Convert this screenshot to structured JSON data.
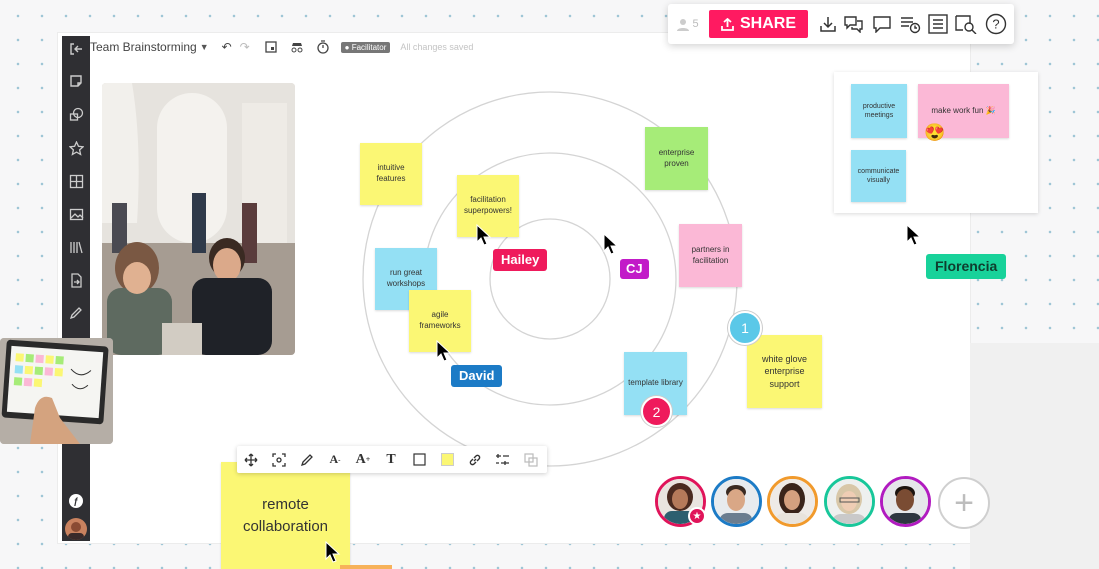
{
  "header": {
    "board_title": "Team Brainstorming",
    "role_badge": "Facilitator",
    "save_status": "All changes saved"
  },
  "share_bar": {
    "viewer_count": "5",
    "share_label": "SHARE",
    "icons": [
      "user-icon",
      "upload-icon",
      "download-icon",
      "comments-icon",
      "chat-icon",
      "activity-icon",
      "list-icon",
      "search-icon",
      "help-icon"
    ]
  },
  "sidebar": {
    "icons": [
      "exit-icon",
      "sticky-note-icon",
      "shapes-icon",
      "star-icon",
      "frame-icon",
      "image-icon",
      "library-icon",
      "import-icon",
      "pen-icon",
      "apps-icon",
      "avatar"
    ]
  },
  "stickies": [
    {
      "id": "intuitive",
      "text": "intuitive features",
      "color": "#fbf774"
    },
    {
      "id": "facilitation",
      "text": "facilitation superpowers!",
      "color": "#fbf774"
    },
    {
      "id": "enterprise",
      "text": "enterprise proven",
      "color": "#a6ec78"
    },
    {
      "id": "workshops",
      "text": "run great workshops",
      "color": "#94e0f4"
    },
    {
      "id": "agile",
      "text": "agile frameworks",
      "color": "#fbf774"
    },
    {
      "id": "partners",
      "text": "partners in facilitation",
      "color": "#fbb8d6"
    },
    {
      "id": "template",
      "text": "template library",
      "color": "#94e0f4"
    },
    {
      "id": "whiteglove",
      "text": "white glove enterprise support",
      "color": "#fbf774"
    },
    {
      "id": "productive",
      "text": "productive meetings",
      "color": "#94e0f4"
    },
    {
      "id": "fun",
      "text": "make work fun 🎉",
      "color": "#fbb8d6"
    },
    {
      "id": "visually",
      "text": "communicate visually",
      "color": "#94e0f4"
    },
    {
      "id": "remote",
      "text": "remote collaboration",
      "color": "#fbf774"
    }
  ],
  "emoji": "😍",
  "collaborators": [
    {
      "name": "Hailey",
      "color": "#ef1a5c"
    },
    {
      "name": "CJ",
      "color": "#c21bc8"
    },
    {
      "name": "David",
      "color": "#1c7bc6"
    },
    {
      "name": "Florencia",
      "color": "#18d29a"
    }
  ],
  "markers": [
    {
      "label": "1",
      "color": "#5bc8e8"
    },
    {
      "label": "2",
      "color": "#ef1a5c"
    }
  ],
  "format_toolbar": {
    "icons": [
      "move-icon",
      "focus-icon",
      "pen-icon",
      "font-smaller-icon",
      "font-larger-icon",
      "text-icon",
      "border-icon",
      "fill-color-icon",
      "link-icon",
      "align-icon",
      "duplicate-icon"
    ],
    "font_smaller": "A",
    "font_larger": "A",
    "text": "T",
    "fill_color": "#fbf774"
  },
  "avatars": [
    {
      "ring": "#e0145a"
    },
    {
      "ring": "#1c7bc6"
    },
    {
      "ring": "#f19a2c"
    },
    {
      "ring": "#18c79a"
    },
    {
      "ring": "#b11bc0"
    }
  ],
  "add_collaborator": "+"
}
